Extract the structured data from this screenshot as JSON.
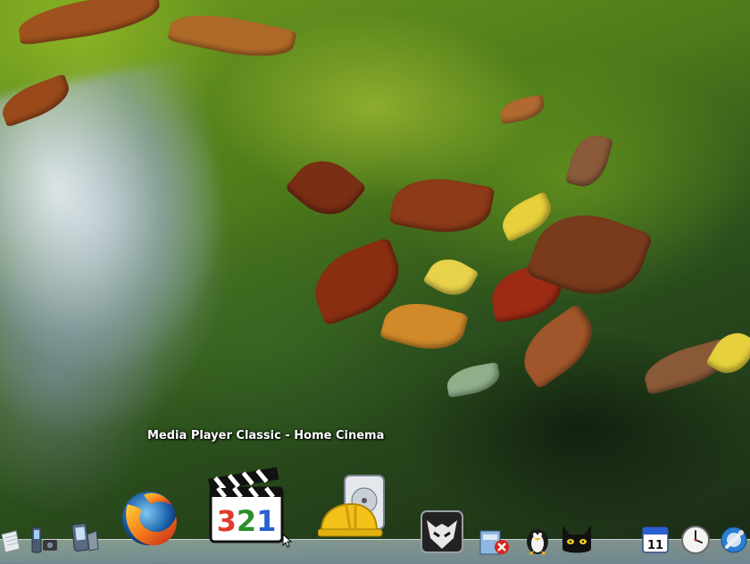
{
  "hover_label": "Media Player Classic - Home Cinema",
  "dock": {
    "icons": [
      "paper-icon",
      "camera-phone-icon",
      "pda-icon",
      "firefox-icon",
      "mpc-hc-icon",
      "harddrive-hardhat-icon",
      "foobar-icon",
      "package-remove-icon",
      "tux-icon",
      "black-cat-icon",
      "calendar-icon",
      "clock-icon",
      "settings-icon"
    ],
    "mpc_digits": "321",
    "calendar_day": "11"
  }
}
